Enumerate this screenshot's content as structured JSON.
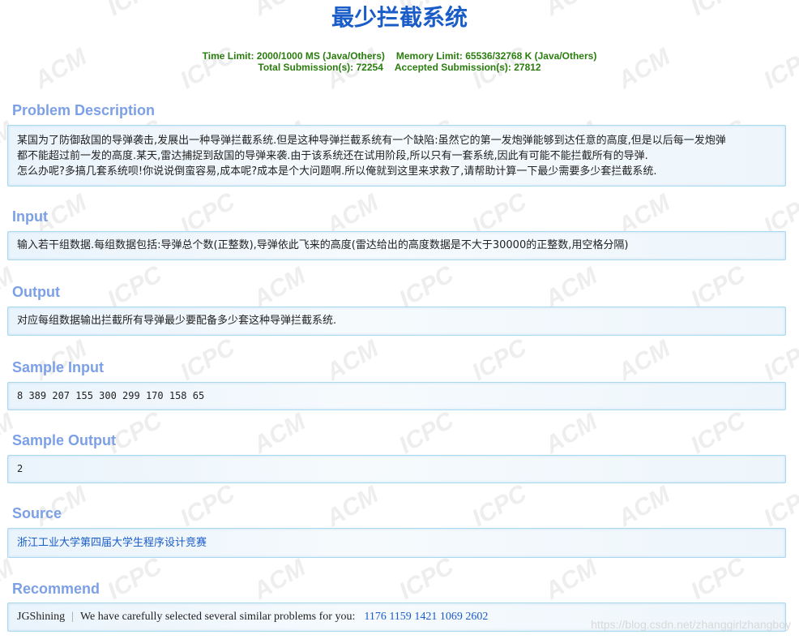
{
  "problem": {
    "title": "最少拦截系统",
    "time_limit": "Time Limit: 2000/1000 MS (Java/Others)",
    "memory_limit": "Memory Limit: 65536/32768 K (Java/Others)",
    "total_submissions": "Total Submission(s): 72254",
    "accepted_submissions": "Accepted Submission(s): 27812"
  },
  "sections": {
    "description": {
      "heading": "Problem Description",
      "lines": [
        "某国为了防御敌国的导弹袭击,发展出一种导弹拦截系统.但是这种导弹拦截系统有一个缺陷:虽然它的第一发炮弹能够到达任意的高度,但是以后每一发炮弹",
        "都不能超过前一发的高度.某天,雷达捕捉到敌国的导弹来袭.由于该系统还在试用阶段,所以只有一套系统,因此有可能不能拦截所有的导弹.",
        "怎么办呢?多搞几套系统呗!你说说倒蛮容易,成本呢?成本是个大问题啊.所以俺就到这里来求救了,请帮助计算一下最少需要多少套拦截系统."
      ]
    },
    "input": {
      "heading": "Input",
      "text": "输入若干组数据.每组数据包括:导弹总个数(正整数),导弹依此飞来的高度(雷达给出的高度数据是不大于30000的正整数,用空格分隔)"
    },
    "output": {
      "heading": "Output",
      "text": "对应每组数据输出拦截所有导弹最少要配备多少套这种导弹拦截系统."
    },
    "sample_input": {
      "heading": "Sample Input",
      "text": "8 389 207 155 300 299 170 158 65"
    },
    "sample_output": {
      "heading": "Sample Output",
      "text": "2"
    },
    "source": {
      "heading": "Source",
      "text": "浙江工业大学第四届大学生程序设计竞赛"
    },
    "recommend": {
      "heading": "Recommend",
      "user": "JGShining",
      "separator": "|",
      "message": "We have carefully selected several similar problems for you:",
      "problems": [
        "1176",
        "1159",
        "1421",
        "1069",
        "2602"
      ]
    }
  },
  "watermark": {
    "words": [
      "ACM",
      "ICPC"
    ],
    "csdn_url": "https://blog.csdn.net/zhanggirlzhangboy"
  },
  "colors": {
    "title": "#1a5cc8",
    "limits": "#2a7d0e",
    "section_heading": "#7ca0e6",
    "box_border": "#a9d8f0",
    "link": "#1a5cc8"
  }
}
